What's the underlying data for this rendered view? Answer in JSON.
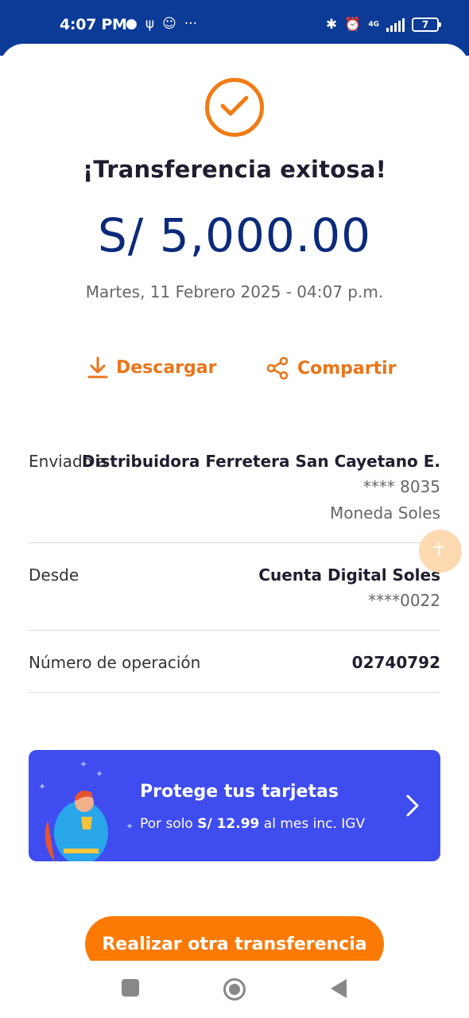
{
  "status_bar": {
    "time": "4:07 PM",
    "network": "4G",
    "battery": "7"
  },
  "receipt": {
    "title": "¡Transferencia exitosa!",
    "amount": "S/ 5,000.00",
    "datetime": "Martes, 11 Febrero 2025 - 04:07 p.m.",
    "download_label": "Descargar",
    "share_label": "Compartir"
  },
  "details": {
    "sent_to_label": "Enviado a",
    "sent_to_name": "Distribuidora Ferretera San Cayetano E.",
    "sent_to_account": "**** 8035",
    "sent_to_currency": "Moneda Soles",
    "from_label": "Desde",
    "from_name": "Cuenta Digital Soles",
    "from_account": "****0022",
    "operation_label": "Número de operación",
    "operation_number": "02740792"
  },
  "promo": {
    "title": "Protege tus tarjetas",
    "sub_prefix": "Por solo ",
    "sub_price": "S/ 12.99",
    "sub_suffix": " al mes inc. IGV"
  },
  "cta": {
    "label": "Realizar otra transferencia"
  },
  "colors": {
    "status_bar": "#0b3a97",
    "accent_orange": "#f07b14",
    "amount_blue": "#0b2a7a",
    "promo_bg": "#3f4cf0"
  }
}
